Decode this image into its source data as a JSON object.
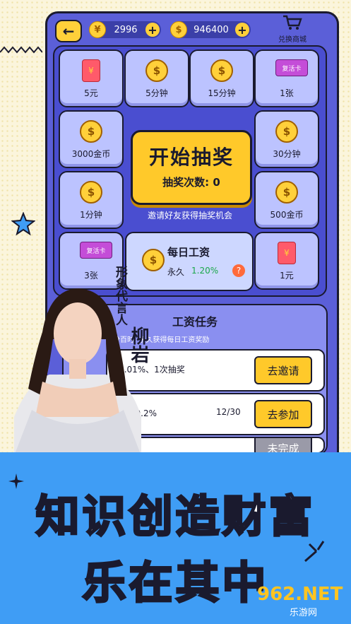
{
  "header": {
    "coupons": "2996",
    "coins": "946400",
    "yuan_symbol": "¥",
    "dollar_symbol": "$",
    "shop_label": "兑换商城"
  },
  "grid": {
    "top": [
      {
        "label": "5元",
        "icon": "red-envelope-icon"
      },
      {
        "label": "5分钟",
        "icon": "coin-stack-icon"
      },
      {
        "label": "15分钟",
        "icon": "coin-stack-icon"
      },
      {
        "label": "1张",
        "icon": "revive-card-icon"
      }
    ],
    "left": [
      {
        "label": "3000金币",
        "icon": "coin-icon"
      },
      {
        "label": "1分钟",
        "icon": "coin-stack-icon"
      },
      {
        "label": "3张",
        "icon": "revive-card-icon"
      }
    ],
    "right": [
      {
        "label": "30分钟",
        "icon": "coin-stack-icon"
      },
      {
        "label": "500金币",
        "icon": "coin-icon"
      },
      {
        "label": "1元",
        "icon": "red-envelope-icon"
      }
    ],
    "card_text": "复活卡"
  },
  "lottery": {
    "start": "开始抽奖",
    "count": "抽奖次数: 0",
    "invite": "邀请好友获得抽奖机会"
  },
  "wage": {
    "title": "每日工资",
    "term": "永久",
    "rate": "1.20%",
    "help": "?"
  },
  "task": {
    "title": "工资任务",
    "desc": "百分百时, 永久获得每日工资奖励",
    "rows": [
      {
        "text": "+0.01%、1次抽奖",
        "progress": "",
        "button": "去邀请"
      },
      {
        "text": "0关 +0.2%",
        "progress": "12/30",
        "button": "去参加"
      },
      {
        "text": "",
        "progress": "",
        "button": "未完成"
      }
    ]
  },
  "spokesperson": {
    "role": "形象代言人",
    "name": "柳岩"
  },
  "banner": {
    "line1": "知识创造财富",
    "line2": "乐在其中"
  },
  "watermark": {
    "brand": "962.NET",
    "site": "乐游网"
  },
  "colors": {
    "frame": "#5b5fd8",
    "accent": "#ffc92a",
    "banner": "#3f9df5",
    "cell": "#bcc3ff"
  }
}
